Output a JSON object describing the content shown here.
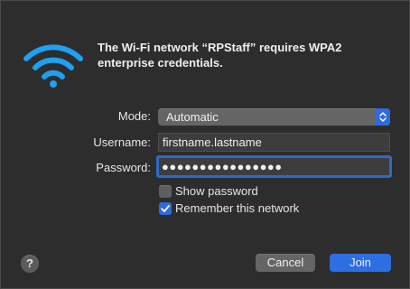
{
  "dialog": {
    "heading": "The Wi-Fi network “RPStaff” requires WPA2 enterprise credentials.",
    "wifi_icon": "wifi-icon"
  },
  "form": {
    "mode_label": "Mode:",
    "mode_value": "Automatic",
    "username_label": "Username:",
    "username_value": "firstname.lastname",
    "password_label": "Password:",
    "password_value": "●●●●●●●●●●●●●●●●",
    "show_password_label": "Show password",
    "show_password_checked": false,
    "remember_label": "Remember this network",
    "remember_checked": true
  },
  "buttons": {
    "help": "?",
    "cancel": "Cancel",
    "join": "Join"
  },
  "colors": {
    "accent": "#2f6be0",
    "wifi": "#1ea1f2",
    "background": "#2d2d2d"
  }
}
